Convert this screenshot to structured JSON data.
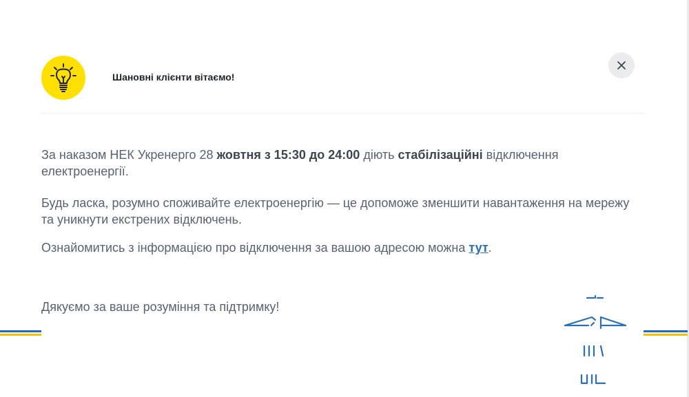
{
  "dialog": {
    "title": "Шановні клієнти вітаємо!",
    "close_label": "×"
  },
  "icons": {
    "header": "lightbulb-icon",
    "close": "close-icon",
    "decoration": "power-tower-icon"
  },
  "colors": {
    "accent_yellow": "#ffe000",
    "link_blue": "#2a6fb3",
    "flag_blue": "#1d6ec0",
    "flag_yellow": "#f2c200"
  },
  "message": {
    "p1_prefix": "За наказом НЕК Укренерго 28 ",
    "p1_bold_time": "жовтня з 15:30 до 24:00",
    "p1_middle": " діють ",
    "p1_bold_type": "стабілізаційні",
    "p1_suffix": " відключення електроенергії.",
    "p2": "Будь ласка, розумно споживайте електроенергію — це допоможе зменшити навантаження на мережу та уникнути екстрених відключень.",
    "p3_prefix": "Ознайомитись з інформацією про відключення за вашою адресою можна ",
    "p3_link": "тут",
    "p3_suffix": ".",
    "p4": "Дякуємо за ваше розуміння та підтримку!"
  }
}
